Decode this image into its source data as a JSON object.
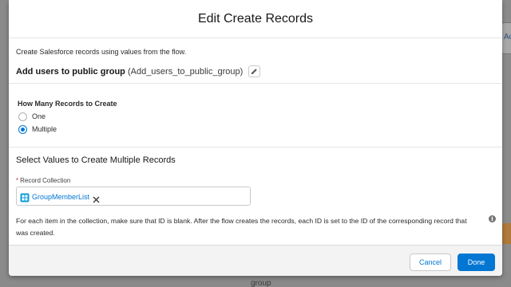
{
  "background": {
    "tab_fragment": "Ac",
    "bottom_text": "group"
  },
  "modal": {
    "title": "Edit Create Records",
    "description": "Create Salesforce records using values from the flow.",
    "element": {
      "label": "Add users to public group",
      "api_name": "(Add_users_to_public_group)",
      "edit_icon": "pencil-icon"
    },
    "record_count": {
      "label": "How Many Records to Create",
      "options": [
        {
          "label": "One",
          "selected": false
        },
        {
          "label": "Multiple",
          "selected": true
        }
      ]
    },
    "values_section": {
      "title": "Select Values to Create Multiple Records",
      "record_collection": {
        "label": "Record Collection",
        "required": true,
        "value": "GroupMemberList",
        "icon": "collection-icon",
        "remove_icon": "close-icon"
      },
      "help_text": "For each item in the collection, make sure that ID is blank. After the flow creates the records, each ID is set to the ID of the corresponding record that was created.",
      "info_icon": "info-icon"
    },
    "footer": {
      "cancel_label": "Cancel",
      "done_label": "Done"
    }
  },
  "colors": {
    "brand_blue": "#0176d3",
    "required_red": "#c23934",
    "overlay_gray": "#7c7c7c"
  }
}
